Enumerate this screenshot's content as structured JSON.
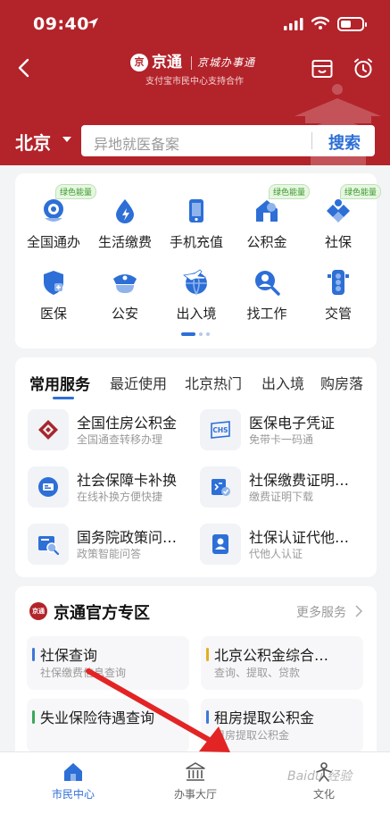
{
  "status_bar": {
    "time": "09:40"
  },
  "header": {
    "brand_seal": "京",
    "brand_name": "京通",
    "brand_slogan": "京城办事通",
    "brand_sub": "支付宝市民中心支持合作",
    "city": "北京",
    "search_placeholder": "异地就医备案",
    "search_button": "搜索",
    "accent_color": "#b3232a"
  },
  "services": [
    {
      "label": "全国通办",
      "icon": "nationwide-service-icon",
      "tag": "绿色能量"
    },
    {
      "label": "生活缴费",
      "icon": "utility-payment-icon",
      "tag": ""
    },
    {
      "label": "手机充值",
      "icon": "phone-recharge-icon",
      "tag": ""
    },
    {
      "label": "公积金",
      "icon": "housing-fund-icon",
      "tag": "绿色能量"
    },
    {
      "label": "社保",
      "icon": "social-security-icon",
      "tag": "绿色能量"
    },
    {
      "label": "医保",
      "icon": "medical-insurance-icon",
      "tag": ""
    },
    {
      "label": "公安",
      "icon": "police-icon",
      "tag": ""
    },
    {
      "label": "出入境",
      "icon": "immigration-icon",
      "tag": ""
    },
    {
      "label": "找工作",
      "icon": "job-search-icon",
      "tag": ""
    },
    {
      "label": "交管",
      "icon": "traffic-light-icon",
      "tag": ""
    }
  ],
  "common": {
    "tabs": [
      "常用服务",
      "最近使用",
      "北京热门",
      "出入境",
      "购房落"
    ],
    "active_tab": "常用服务",
    "items": [
      {
        "title": "全国住房公积金",
        "sub": "全国通查转移办理",
        "icon": "housing-fund-logo-icon"
      },
      {
        "title": "医保电子凭证",
        "sub": "免带卡一码通",
        "icon": "chs-icon"
      },
      {
        "title": "社会保障卡补换",
        "sub": "在线补换方便快捷",
        "icon": "social-card-icon"
      },
      {
        "title": "社保缴费证明…",
        "sub": "缴费证明下载",
        "icon": "payment-proof-icon"
      },
      {
        "title": "国务院政策问…",
        "sub": "政策智能问答",
        "icon": "policy-search-icon"
      },
      {
        "title": "社保认证代他…",
        "sub": "代他人认证",
        "icon": "person-card-icon"
      }
    ],
    "chs_text": "CHS"
  },
  "official": {
    "seal": "京通",
    "title": "京通官方专区",
    "more": "更多服务",
    "tiles": [
      {
        "title": "社保查询",
        "sub": "社保缴费信息查询",
        "color": "#3c78d8"
      },
      {
        "title": "北京公积金综合…",
        "sub": "查询、提取、贷款",
        "color": "#e0b020"
      },
      {
        "title": "失业保险待遇查询",
        "sub": "",
        "color": "#3aa85a"
      },
      {
        "title": "租房提取公积金",
        "sub": "租房提取公积金",
        "color": "#3c78d8"
      }
    ]
  },
  "tabbar": [
    {
      "label": "市民中心",
      "icon": "home-icon",
      "active": true
    },
    {
      "label": "办事大厅",
      "icon": "hall-icon",
      "active": false
    },
    {
      "label": "文化",
      "icon": "culture-icon",
      "active": false
    }
  ],
  "watermark": "Baidu 经验"
}
